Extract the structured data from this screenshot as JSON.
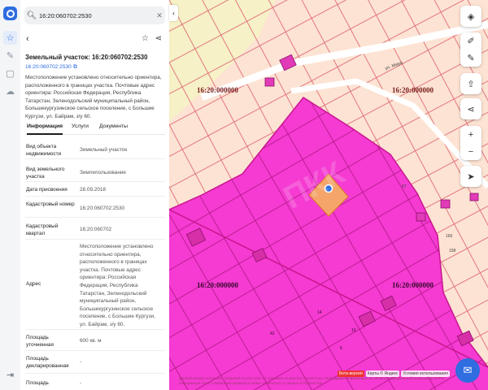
{
  "search": {
    "value": "16:20:060702:2530"
  },
  "parcel": {
    "title": "Земельный участок: 16:20:060702:2530",
    "number": "16:20:060702:2530",
    "description": "Местоположение установлено относительно ориентира, расположенного в границах участка. Почтовые адрес ориентира: Российская Федерация, Республика Татарстан, Зеленодольский муниципальный район, Большекургузинское сельское поселение, с Большие Кургузи, ул. Байрам, з/у 60."
  },
  "tabs": [
    {
      "label": "Информация",
      "active": true
    },
    {
      "label": "Услуги",
      "active": false
    },
    {
      "label": "Документы",
      "active": false
    }
  ],
  "info_rows": [
    {
      "label": "Вид объекта недвижимости",
      "value": "Земельный участок"
    },
    {
      "label": "Вид земельного участка",
      "value": "Землепользование"
    },
    {
      "label": "Дата присвоения",
      "value": "28.09.2018"
    },
    {
      "label": "Кадастровый номер",
      "value": "16:20:060702:2530"
    },
    {
      "label": "Кадастровый квартал",
      "value": "16:20:060702"
    },
    {
      "label": "Адрес",
      "value": "Местоположение установлено относительно ориентира, расположенного в границах участка. Почтовые адрес ориентира: Российская Федерация, Республика Татарстан, Зеленодольский муниципальный район, Большекургузинское сельское поселение, с Большие Кургузи, ул. Байрам, з/у 60."
    },
    {
      "label": "Площадь уточненная",
      "value": "600 кв. м"
    },
    {
      "label": "Площадь декларированная",
      "value": "-"
    },
    {
      "label": "Площадь",
      "value": "-"
    }
  ],
  "map": {
    "quarter_labels": [
      "16:20:000000",
      "16:20:000000",
      "16:20:000000",
      "16:20:000000"
    ],
    "street_label": "ул. Мира",
    "plot_numbers": [
      "67",
      "160",
      "158",
      "42",
      "14",
      "10",
      "6"
    ],
    "watermark": "ПКК",
    "attribution": [
      "Бета-версия",
      "Карты © Яндекс",
      "Условия использования"
    ],
    "legal_note": "Данный ресурс использует сведения из реестров, их описание из реестра Росреестра. Приводимая информация не является официальной выпиской из ЕГРН, информация носит справочный характер и может отличаться от данных в Росреестре."
  },
  "colors": {
    "accent": "#2f6de1",
    "parcel_magenta": "#f53bd2",
    "parcel_border": "#c9178f",
    "background_plots": "#fde3d3",
    "selected_plot": "#f5a46a"
  }
}
